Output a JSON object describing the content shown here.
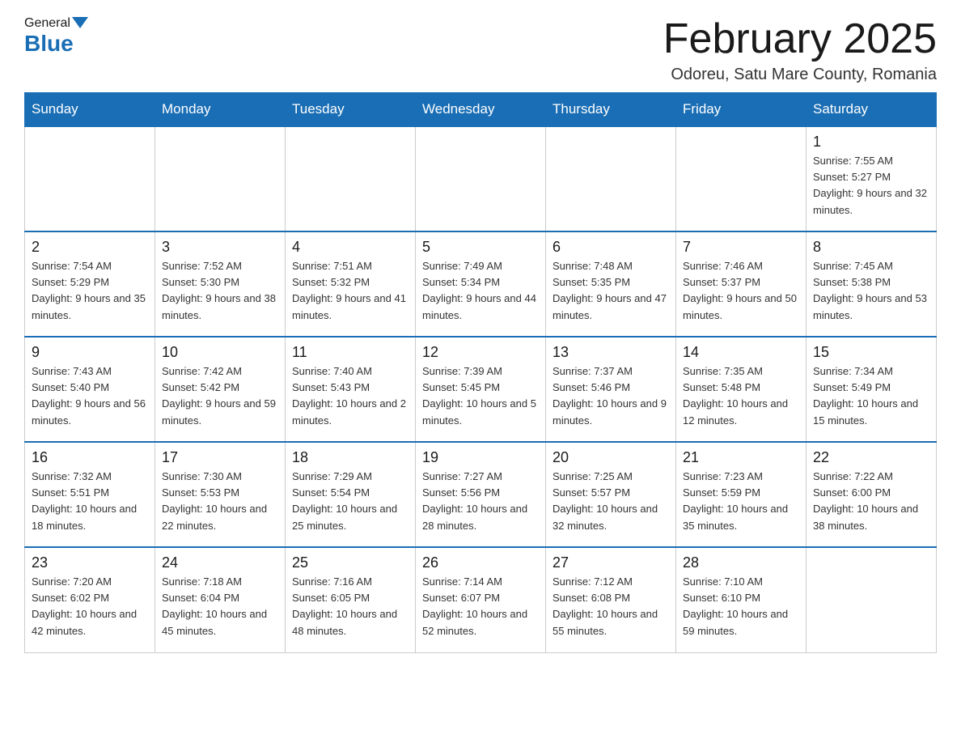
{
  "logo": {
    "general": "General",
    "blue": "Blue"
  },
  "header": {
    "title": "February 2025",
    "subtitle": "Odoreu, Satu Mare County, Romania"
  },
  "days_of_week": [
    "Sunday",
    "Monday",
    "Tuesday",
    "Wednesday",
    "Thursday",
    "Friday",
    "Saturday"
  ],
  "weeks": [
    [
      {
        "day": "",
        "info": ""
      },
      {
        "day": "",
        "info": ""
      },
      {
        "day": "",
        "info": ""
      },
      {
        "day": "",
        "info": ""
      },
      {
        "day": "",
        "info": ""
      },
      {
        "day": "",
        "info": ""
      },
      {
        "day": "1",
        "info": "Sunrise: 7:55 AM\nSunset: 5:27 PM\nDaylight: 9 hours and 32 minutes."
      }
    ],
    [
      {
        "day": "2",
        "info": "Sunrise: 7:54 AM\nSunset: 5:29 PM\nDaylight: 9 hours and 35 minutes."
      },
      {
        "day": "3",
        "info": "Sunrise: 7:52 AM\nSunset: 5:30 PM\nDaylight: 9 hours and 38 minutes."
      },
      {
        "day": "4",
        "info": "Sunrise: 7:51 AM\nSunset: 5:32 PM\nDaylight: 9 hours and 41 minutes."
      },
      {
        "day": "5",
        "info": "Sunrise: 7:49 AM\nSunset: 5:34 PM\nDaylight: 9 hours and 44 minutes."
      },
      {
        "day": "6",
        "info": "Sunrise: 7:48 AM\nSunset: 5:35 PM\nDaylight: 9 hours and 47 minutes."
      },
      {
        "day": "7",
        "info": "Sunrise: 7:46 AM\nSunset: 5:37 PM\nDaylight: 9 hours and 50 minutes."
      },
      {
        "day": "8",
        "info": "Sunrise: 7:45 AM\nSunset: 5:38 PM\nDaylight: 9 hours and 53 minutes."
      }
    ],
    [
      {
        "day": "9",
        "info": "Sunrise: 7:43 AM\nSunset: 5:40 PM\nDaylight: 9 hours and 56 minutes."
      },
      {
        "day": "10",
        "info": "Sunrise: 7:42 AM\nSunset: 5:42 PM\nDaylight: 9 hours and 59 minutes."
      },
      {
        "day": "11",
        "info": "Sunrise: 7:40 AM\nSunset: 5:43 PM\nDaylight: 10 hours and 2 minutes."
      },
      {
        "day": "12",
        "info": "Sunrise: 7:39 AM\nSunset: 5:45 PM\nDaylight: 10 hours and 5 minutes."
      },
      {
        "day": "13",
        "info": "Sunrise: 7:37 AM\nSunset: 5:46 PM\nDaylight: 10 hours and 9 minutes."
      },
      {
        "day": "14",
        "info": "Sunrise: 7:35 AM\nSunset: 5:48 PM\nDaylight: 10 hours and 12 minutes."
      },
      {
        "day": "15",
        "info": "Sunrise: 7:34 AM\nSunset: 5:49 PM\nDaylight: 10 hours and 15 minutes."
      }
    ],
    [
      {
        "day": "16",
        "info": "Sunrise: 7:32 AM\nSunset: 5:51 PM\nDaylight: 10 hours and 18 minutes."
      },
      {
        "day": "17",
        "info": "Sunrise: 7:30 AM\nSunset: 5:53 PM\nDaylight: 10 hours and 22 minutes."
      },
      {
        "day": "18",
        "info": "Sunrise: 7:29 AM\nSunset: 5:54 PM\nDaylight: 10 hours and 25 minutes."
      },
      {
        "day": "19",
        "info": "Sunrise: 7:27 AM\nSunset: 5:56 PM\nDaylight: 10 hours and 28 minutes."
      },
      {
        "day": "20",
        "info": "Sunrise: 7:25 AM\nSunset: 5:57 PM\nDaylight: 10 hours and 32 minutes."
      },
      {
        "day": "21",
        "info": "Sunrise: 7:23 AM\nSunset: 5:59 PM\nDaylight: 10 hours and 35 minutes."
      },
      {
        "day": "22",
        "info": "Sunrise: 7:22 AM\nSunset: 6:00 PM\nDaylight: 10 hours and 38 minutes."
      }
    ],
    [
      {
        "day": "23",
        "info": "Sunrise: 7:20 AM\nSunset: 6:02 PM\nDaylight: 10 hours and 42 minutes."
      },
      {
        "day": "24",
        "info": "Sunrise: 7:18 AM\nSunset: 6:04 PM\nDaylight: 10 hours and 45 minutes."
      },
      {
        "day": "25",
        "info": "Sunrise: 7:16 AM\nSunset: 6:05 PM\nDaylight: 10 hours and 48 minutes."
      },
      {
        "day": "26",
        "info": "Sunrise: 7:14 AM\nSunset: 6:07 PM\nDaylight: 10 hours and 52 minutes."
      },
      {
        "day": "27",
        "info": "Sunrise: 7:12 AM\nSunset: 6:08 PM\nDaylight: 10 hours and 55 minutes."
      },
      {
        "day": "28",
        "info": "Sunrise: 7:10 AM\nSunset: 6:10 PM\nDaylight: 10 hours and 59 minutes."
      },
      {
        "day": "",
        "info": ""
      }
    ]
  ]
}
